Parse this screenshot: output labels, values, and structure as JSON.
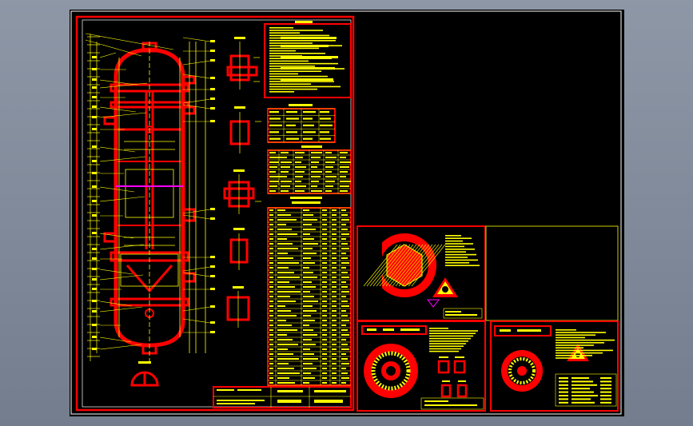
{
  "viewer": {
    "background": "#7f8999",
    "canvas_background": "#000000"
  },
  "colors": {
    "frame": "#ff0000",
    "text": "#ffff00",
    "border": "#ffffff",
    "accent": "#ff00ff"
  },
  "drawing": {
    "sheets": [
      {
        "name": "main-vessel-assembly-sheet"
      },
      {
        "name": "blank-upper-right-sheet"
      },
      {
        "name": "detail-sheet-top"
      },
      {
        "name": "detail-sheet-bottom-left"
      },
      {
        "name": "detail-sheet-bottom-right"
      },
      {
        "name": "empty-detail-box"
      }
    ]
  }
}
